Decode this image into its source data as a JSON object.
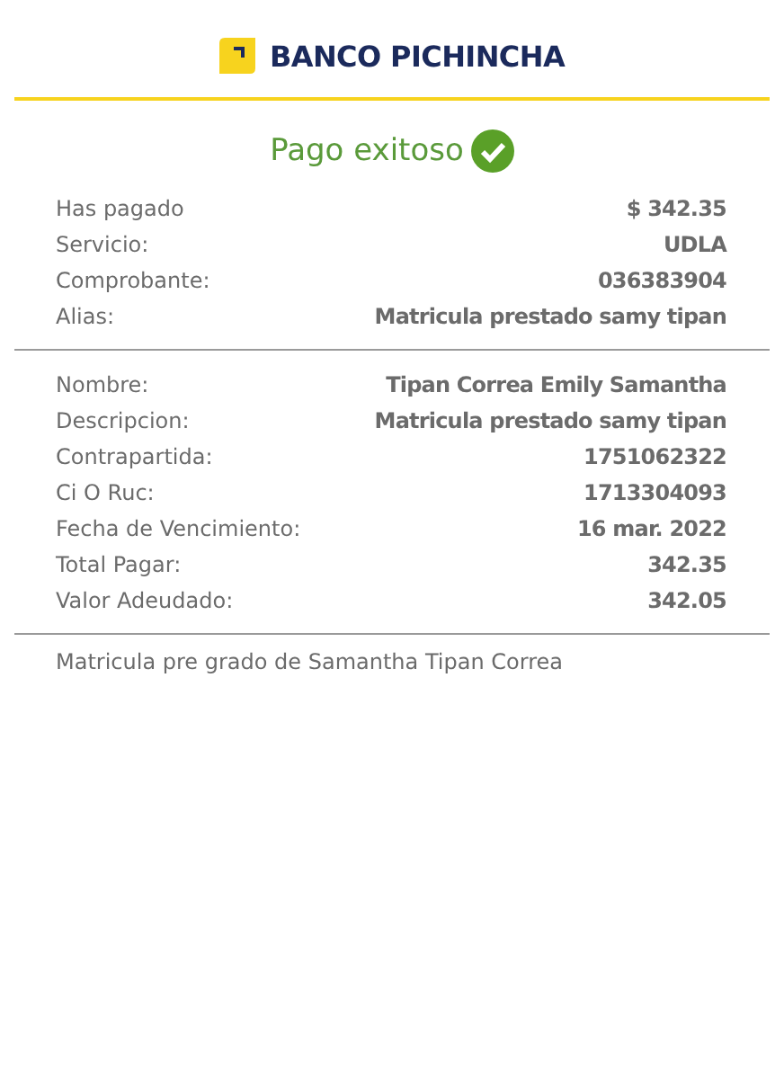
{
  "header": {
    "bank_name": "BANCO PICHINCHA"
  },
  "status": {
    "title": "Pago exitoso"
  },
  "sections": [
    {
      "rows": [
        {
          "label": "Has pagado",
          "value": "$ 342.35"
        },
        {
          "label": "Servicio:",
          "value": "UDLA"
        },
        {
          "label": "Comprobante:",
          "value": "036383904"
        },
        {
          "label": "Alias:",
          "value": "Matricula prestado samy tipan"
        }
      ]
    },
    {
      "rows": [
        {
          "label": "Nombre:",
          "value": "Tipan Correa Emily Samantha"
        },
        {
          "label": "Descripcion:",
          "value": "Matricula prestado samy tipan"
        },
        {
          "label": "Contrapartida:",
          "value": "1751062322"
        },
        {
          "label": "Ci O Ruc:",
          "value": "1713304093"
        },
        {
          "label": "Fecha de Vencimiento:",
          "value": "16 mar. 2022"
        },
        {
          "label": "Total Pagar:",
          "value": "342.35"
        },
        {
          "label": "Valor Adeudado:",
          "value": "342.05"
        }
      ]
    }
  ],
  "note": "Matricula pre grado de Samantha Tipan Correa"
}
